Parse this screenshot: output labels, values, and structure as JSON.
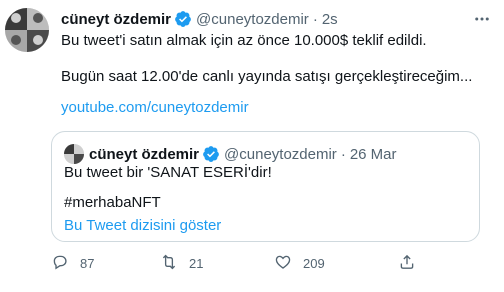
{
  "tweet": {
    "author_name": "cüneyt özdemir",
    "author_handle": "@cuneytozdemir",
    "separator": "·",
    "time": "2s",
    "line1": "Bu tweet'i satın almak için az önce 10.000$ teklif edildi.",
    "line2": "Bugün saat 12.00'de canlı yayında satışı gerçekleştireceğim...",
    "link": "youtube.com/cuneytozdemir"
  },
  "quote": {
    "author_name": "cüneyt özdemir",
    "author_handle": "@cuneytozdemir",
    "separator": "·",
    "time": "26 Mar",
    "line1": "Bu tweet bir 'SANAT ESERİ'dir!",
    "hashtag": "#merhabaNFT",
    "show_thread": "Bu Tweet dizisini göster"
  },
  "actions": {
    "reply_count": "87",
    "retweet_count": "21",
    "like_count": "209"
  },
  "colors": {
    "link": "#1d9bf0",
    "secondary_text": "#536471",
    "border": "#cfd9de",
    "verified": "#1d9bf0"
  },
  "icons": [
    "verified-badge-icon",
    "more-icon",
    "reply-icon",
    "retweet-icon",
    "like-icon",
    "share-icon"
  ]
}
